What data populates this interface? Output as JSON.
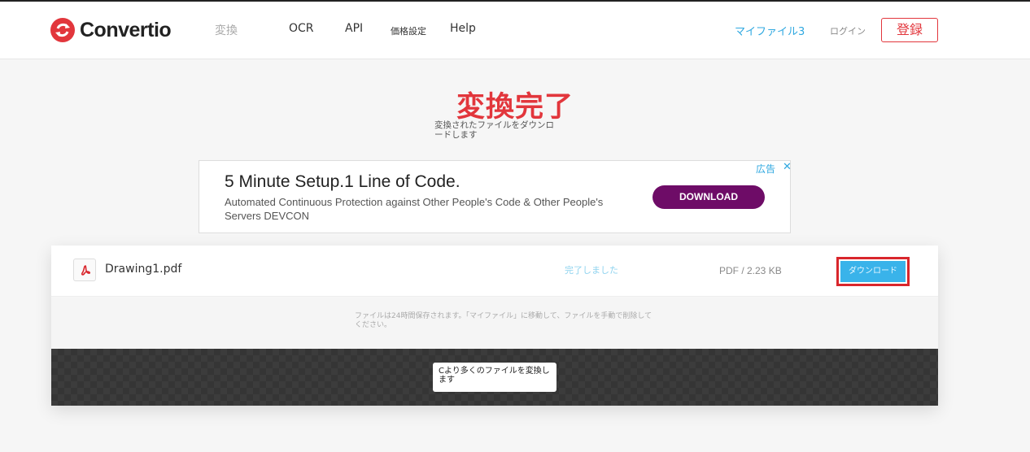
{
  "header": {
    "logo_text": "Convertio",
    "nav": {
      "convert": "変換",
      "ocr": "OCR",
      "api": "API",
      "pricing": "価格設定",
      "help": "Help"
    },
    "my_files": "マイファイル",
    "my_files_count": "3",
    "login": "ログイン",
    "register": "登録"
  },
  "main": {
    "title": "変換完了",
    "subtitle": "変換されたファイルをダウンロードします"
  },
  "ad": {
    "title": "5 Minute Setup.1 Line of Code.",
    "text": "Automated Continuous Protection against Other People's Code & Other People's Servers DEVCON",
    "button": "DOWNLOAD",
    "label": "広告",
    "close": "✕"
  },
  "file": {
    "name": "Drawing1.pdf",
    "status": "完了しました",
    "meta": "PDF / 2.23 KB",
    "download": "ダウンロード"
  },
  "info": {
    "text": "ファイルは24時間保存されます。「マイファイル」に移動して、ファイルを手動で削除してください。"
  },
  "promo": {
    "text": "Cより多くのファイルを変換します"
  },
  "colors": {
    "brand_red": "#e2363c",
    "link_blue": "#2fa8e0",
    "download_blue": "#39b3ea",
    "ad_purple": "#6e0c67"
  }
}
